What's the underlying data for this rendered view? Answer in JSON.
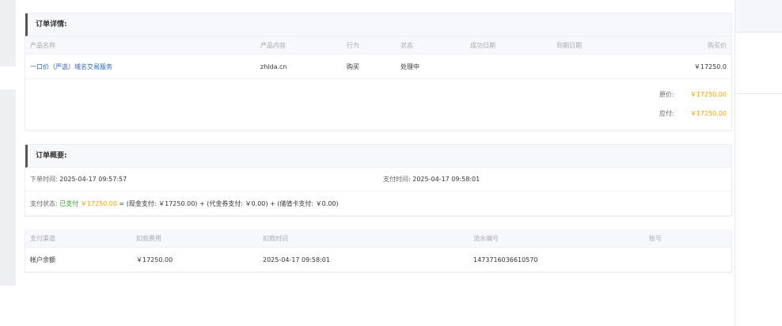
{
  "order_details": {
    "title": "订单详情:",
    "columns": [
      "产品名称",
      "产品内容",
      "行为",
      "状态",
      "成功日期",
      "到期日期",
      "购买价"
    ],
    "items": [
      {
        "name": "一口价（严选）域名交易服务",
        "content": "zhida.cn",
        "action": "购买",
        "status": "处理中",
        "success_date": "",
        "expire_date": "",
        "price": "￥17250.0"
      }
    ],
    "original_price_label": "原价:",
    "original_price": "￥17250.00",
    "payable_label": "应付:",
    "payable": "￥17250.00"
  },
  "order_summary": {
    "title": "订单概要:",
    "order_time_label": "下单时间:",
    "order_time": "2025-04-17 09:57:57",
    "pay_time_label": "支付时间:",
    "pay_time": "2025-04-17 09:58:01",
    "pay_status_label": "支付状态:",
    "pay_status": "已支付",
    "pay_amount": "￥17250.00",
    "pay_breakdown": "= (现金支付: ￥17250.00) + (代金券支付: ￥0.00) + (储值卡支付: ￥0.00)"
  },
  "payments": {
    "columns": [
      "支付渠道",
      "扣款费用",
      "扣款时间",
      "流水编号",
      "账号"
    ],
    "rows": [
      {
        "channel": "帐户余额",
        "fee": "￥17250.00",
        "time": "2025-04-17 09:58:01",
        "serial": "1473716036610570",
        "account": ""
      }
    ]
  }
}
